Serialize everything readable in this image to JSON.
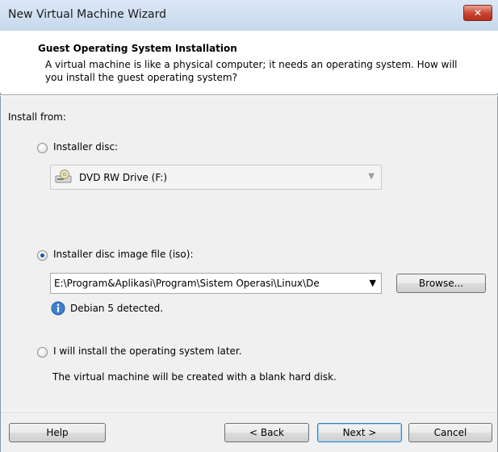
{
  "window": {
    "title": "New Virtual Machine Wizard",
    "close_glyph": "✕"
  },
  "header": {
    "title": "Guest Operating System Installation",
    "description": "A virtual machine is like a physical computer; it needs an operating system. How will you install the guest operating system?"
  },
  "install_from": {
    "label": "Install from:"
  },
  "options": {
    "disc": {
      "label": "Installer disc:",
      "selected": false,
      "drive_value": "DVD RW Drive (F:)",
      "drive_icon": "dvd-drive-icon"
    },
    "iso": {
      "label": "Installer disc image file (iso):",
      "selected": true,
      "path_value": "E:\\Program&Aplikasi\\Program\\Sistem Operasi\\Linux\\De",
      "browse_label": "Browse...",
      "detected_text": "Debian 5 detected.",
      "detected_icon": "info-icon"
    },
    "later": {
      "label": "I will install the operating system later.",
      "selected": false,
      "note": "The virtual machine will be created with a blank hard disk."
    }
  },
  "footer": {
    "help": "Help",
    "back": "< Back",
    "next": "Next >",
    "cancel": "Cancel"
  },
  "colors": {
    "accent": "#1e58b3",
    "titlebar": "#c7d8ee",
    "close": "#c7432f",
    "content_bg": "#f0f0f0"
  }
}
